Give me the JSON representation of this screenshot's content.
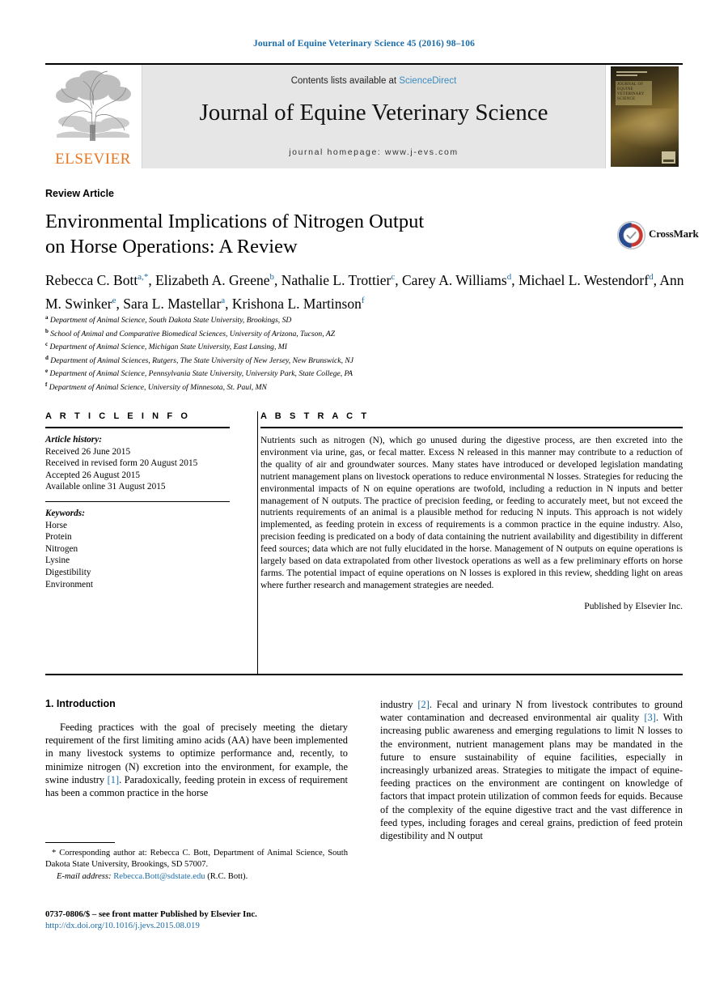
{
  "running_head": "Journal of Equine Veterinary Science 45 (2016) 98–106",
  "masthead": {
    "publisher_wordmark": "ELSEVIER",
    "contents_prefix": "Contents lists available at ",
    "contents_link": "ScienceDirect",
    "journal_title": "Journal of Equine Veterinary Science",
    "homepage": "journal homepage: www.j-evs.com",
    "cover_title_lines": [
      "JOURNAL OF",
      "EQUINE",
      "VETERINARY",
      "SCIENCE"
    ]
  },
  "article": {
    "kind": "Review Article",
    "title_line1": "Environmental Implications of Nitrogen Output",
    "title_line2": "on Horse Operations: A Review",
    "crossmark_label": "CrossMark"
  },
  "authors": [
    {
      "name": "Rebecca C. Bott",
      "marks": "a,*"
    },
    {
      "name": "Elizabeth A. Greene",
      "marks": "b"
    },
    {
      "name": "Nathalie L. Trottier",
      "marks": "c"
    },
    {
      "name": "Carey A. Williams",
      "marks": "d"
    },
    {
      "name": "Michael L. Westendorf",
      "marks": "d"
    },
    {
      "name": "Ann M. Swinker",
      "marks": "e"
    },
    {
      "name": "Sara L. Mastellar",
      "marks": "a"
    },
    {
      "name": "Krishona L. Martinson",
      "marks": "f"
    }
  ],
  "affiliations": [
    {
      "mark": "a",
      "text": "Department of Animal Science, South Dakota State University, Brookings, SD"
    },
    {
      "mark": "b",
      "text": "School of Animal and Comparative Biomedical Sciences, University of Arizona, Tucson, AZ"
    },
    {
      "mark": "c",
      "text": "Department of Animal Science, Michigan State University, East Lansing, MI"
    },
    {
      "mark": "d",
      "text": "Department of Animal Sciences, Rutgers, The State University of New Jersey, New Brunswick, NJ"
    },
    {
      "mark": "e",
      "text": "Department of Animal Science, Pennsylvania State University, University Park, State College, PA"
    },
    {
      "mark": "f",
      "text": "Department of Animal Science, University of Minnesota, St. Paul, MN"
    }
  ],
  "article_info": {
    "heading": "A R T I C L E   I N F O",
    "history_heading": "Article history:",
    "history": [
      "Received 26 June 2015",
      "Received in revised form 20 August 2015",
      "Accepted 26 August 2015",
      "Available online 31 August 2015"
    ],
    "keywords_heading": "Keywords:",
    "keywords": [
      "Horse",
      "Protein",
      "Nitrogen",
      "Lysine",
      "Digestibility",
      "Environment"
    ]
  },
  "abstract": {
    "heading": "A B S T R A C T",
    "text": "Nutrients such as nitrogen (N), which go unused during the digestive process, are then excreted into the environment via urine, gas, or fecal matter. Excess N released in this manner may contribute to a reduction of the quality of air and groundwater sources. Many states have introduced or developed legislation mandating nutrient management plans on livestock operations to reduce environmental N losses. Strategies for reducing the environmental impacts of N on equine operations are twofold, including a reduction in N inputs and better management of N outputs. The practice of precision feeding, or feeding to accurately meet, but not exceed the nutrients requirements of an animal is a plausible method for reducing N inputs. This approach is not widely implemented, as feeding protein in excess of requirements is a common practice in the equine industry. Also, precision feeding is predicated on a body of data containing the nutrient availability and digestibility in different feed sources; data which are not fully elucidated in the horse. Management of N outputs on equine operations is largely based on data extrapolated from other livestock operations as well as a few preliminary efforts on horse farms. The potential impact of equine operations on N losses is explored in this review, shedding light on areas where further research and management strategies are needed.",
    "publisher_note": "Published by Elsevier Inc."
  },
  "body": {
    "section_heading": "1. Introduction",
    "left_para_a": "Feeding practices with the goal of precisely meeting the dietary requirement of the first limiting amino acids (AA) have been implemented in many livestock systems to optimize performance and, recently, to minimize nitrogen (N) excretion into the environment, for example, the swine industry ",
    "left_ref_1": "[1]",
    "left_para_b": ". Paradoxically, feeding protein in excess of requirement has been a common practice in the horse",
    "right_para_a": "industry ",
    "right_ref_2": "[2]",
    "right_para_b": ". Fecal and urinary N from livestock contributes to ground water contamination and decreased environmental air quality ",
    "right_ref_3": "[3]",
    "right_para_c": ". With increasing public awareness and emerging regulations to limit N losses to the environment, nutrient management plans may be mandated in the future to ensure sustainability of equine facilities, especially in increasingly urbanized areas. Strategies to mitigate the impact of equine-feeding practices on the environment are contingent on knowledge of factors that impact protein utilization of common feeds for equids. Because of the complexity of the equine digestive tract and the vast difference in feed types, including forages and cereal grains, prediction of feed protein digestibility and N output"
  },
  "footnotes": {
    "corresponding_marker": "*",
    "corresponding": "Corresponding author at: Rebecca C. Bott, Department of Animal Science, South Dakota State University, Brookings, SD 57007.",
    "email_label": "E-mail address:",
    "email": "Rebecca.Bott@sdstate.edu",
    "email_suffix": "(R.C. Bott).",
    "issn_line": "0737-0806/$ – see front matter Published by Elsevier Inc.",
    "doi": "http://dx.doi.org/10.1016/j.jevs.2015.08.019"
  },
  "colors": {
    "link_blue": "#1a6ca8",
    "elsevier_orange": "#e87722",
    "masthead_grey": "#e6e6e6"
  }
}
